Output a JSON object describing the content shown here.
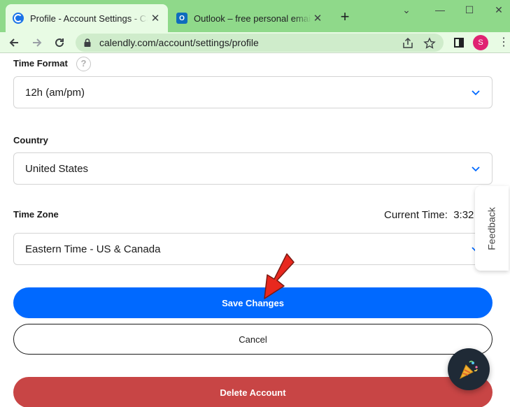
{
  "browser": {
    "tabs": [
      {
        "title": "Profile - Account Settings - Calendly",
        "favicon": "calendly-icon",
        "active": true
      },
      {
        "title": "Outlook – free personal email and calendar",
        "favicon": "outlook-icon",
        "active": false
      }
    ],
    "new_tab_label": "+",
    "url": "calendly.com/account/settings/profile",
    "profile_initial": "S"
  },
  "form": {
    "time_format": {
      "label": "Time Format",
      "value": "12h (am/pm)",
      "help": "?"
    },
    "country": {
      "label": "Country",
      "value": "United States"
    },
    "time_zone": {
      "label": "Time Zone",
      "value": "Eastern Time - US & Canada",
      "current_time_label": "Current Time:",
      "current_time_value": "3:32"
    }
  },
  "actions": {
    "save": "Save Changes",
    "cancel": "Cancel",
    "delete": "Delete Account"
  },
  "feedback_label": "Feedback",
  "colors": {
    "primary": "#0069ff",
    "danger": "#c84545",
    "chrome_frame": "#8fd98a",
    "annotation_arrow": "#e8281e"
  }
}
